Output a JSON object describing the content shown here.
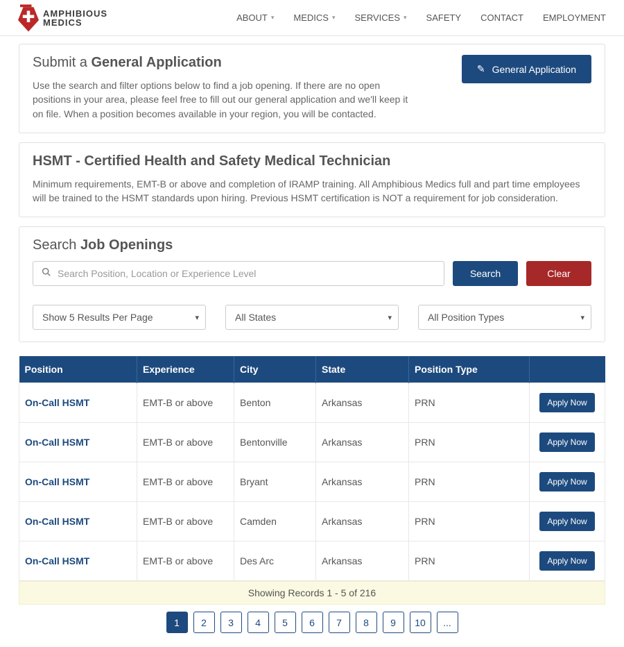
{
  "brand": {
    "line1": "AMPHIBIOUS",
    "line2": "MEDICS"
  },
  "nav": {
    "about": "ABOUT",
    "medics": "MEDICS",
    "services": "SERVICES",
    "safety": "SAFETY",
    "contact": "CONTACT",
    "employment": "EMPLOYMENT"
  },
  "submit": {
    "title_light": "Submit a ",
    "title_bold": "General Application",
    "text": "Use the search and filter options below to find a job opening. If there are no open positions in your area, please feel free to fill out our general application and we'll keep it on file. When a position becomes available in your region, you will be contacted.",
    "button": "General Application"
  },
  "hsmt": {
    "title": "HSMT - Certified Health and Safety Medical Technician",
    "text": "Minimum requirements, EMT-B or above and completion of IRAMP training. All Amphibious Medics full and part time employees will be trained to the HSMT standards upon hiring. Previous HSMT certification is NOT a requirement for job consideration."
  },
  "search": {
    "title_light": "Search ",
    "title_bold": "Job Openings",
    "placeholder": "Search Position, Location or Experience Level",
    "search_btn": "Search",
    "clear_btn": "Clear",
    "filters": {
      "per_page": "Show 5 Results Per Page",
      "state": "All States",
      "type": "All Position Types"
    }
  },
  "table": {
    "headers": {
      "position": "Position",
      "experience": "Experience",
      "city": "City",
      "state": "State",
      "type": "Position Type"
    },
    "rows": [
      {
        "position": "On-Call HSMT",
        "experience": "EMT-B or above",
        "city": "Benton",
        "state": "Arkansas",
        "type": "PRN"
      },
      {
        "position": "On-Call HSMT",
        "experience": "EMT-B or above",
        "city": "Bentonville",
        "state": "Arkansas",
        "type": "PRN"
      },
      {
        "position": "On-Call HSMT",
        "experience": "EMT-B or above",
        "city": "Bryant",
        "state": "Arkansas",
        "type": "PRN"
      },
      {
        "position": "On-Call HSMT",
        "experience": "EMT-B or above",
        "city": "Camden",
        "state": "Arkansas",
        "type": "PRN"
      },
      {
        "position": "On-Call HSMT",
        "experience": "EMT-B or above",
        "city": "Des Arc",
        "state": "Arkansas",
        "type": "PRN"
      }
    ],
    "apply_label": "Apply Now"
  },
  "records": "Showing Records 1 - 5  of  216",
  "pager": {
    "pages": [
      "1",
      "2",
      "3",
      "4",
      "5",
      "6",
      "7",
      "8",
      "9",
      "10",
      "..."
    ],
    "active": "1"
  }
}
